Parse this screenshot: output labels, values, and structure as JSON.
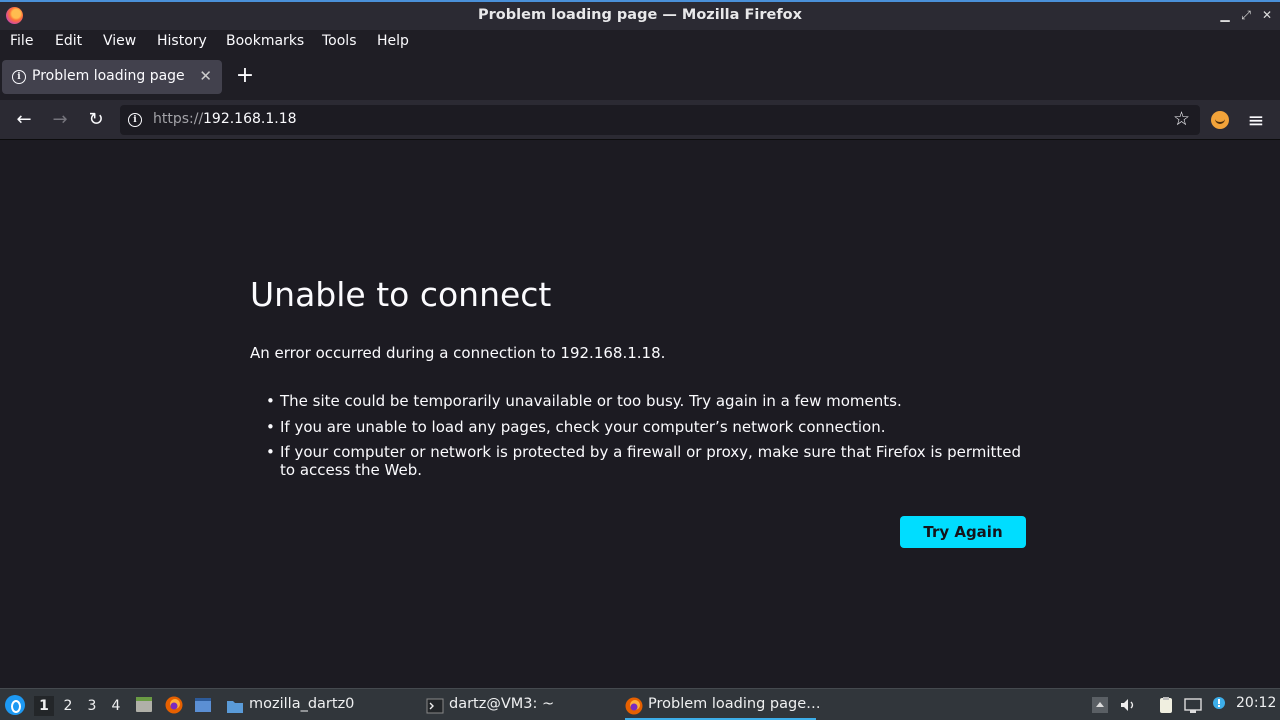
{
  "window": {
    "title": "Problem loading page — Mozilla Firefox",
    "minimize_glyph": "▁",
    "maximize_glyph": "⤢",
    "close_glyph": "✕"
  },
  "menu": {
    "items": [
      "File",
      "Edit",
      "View",
      "History",
      "Bookmarks",
      "Tools",
      "Help"
    ]
  },
  "tabs": [
    {
      "label": "Problem loading page",
      "active": true,
      "icon": "info-icon",
      "close_glyph": "✕"
    }
  ],
  "new_tab_glyph": "+",
  "nav": {
    "back_glyph": "←",
    "forward_glyph": "→",
    "reload_glyph": "↻",
    "url_scheme": "https://",
    "url_host": "192.168.1.18",
    "bookmark_glyph": "☆",
    "menu_glyph": "≡"
  },
  "error_page": {
    "title": "Unable to connect",
    "description": "An error occurred during a connection to 192.168.1.18.",
    "bullets": [
      "The site could be temporarily unavailable or too busy. Try again in a few moments.",
      "If you are unable to load any pages, check your computer’s network connection.",
      "If your computer or network is protected by a firewall or proxy, make sure that Firefox is permitted to access the Web."
    ],
    "button_label": "Try Again",
    "button_color": "#00ddff"
  },
  "taskbar": {
    "workspaces": [
      "1",
      "2",
      "3",
      "4"
    ],
    "active_workspace": "1",
    "tasks": [
      {
        "label": "mozilla_dartz0",
        "icon": "folder-icon",
        "active": false
      },
      {
        "label": "dartz@VM3: ~",
        "icon": "terminal-icon",
        "active": false
      },
      {
        "label": "Problem loading page…",
        "icon": "firefox-icon",
        "active": true
      }
    ],
    "clock": "20:12",
    "accent_color": "#3daee9"
  }
}
